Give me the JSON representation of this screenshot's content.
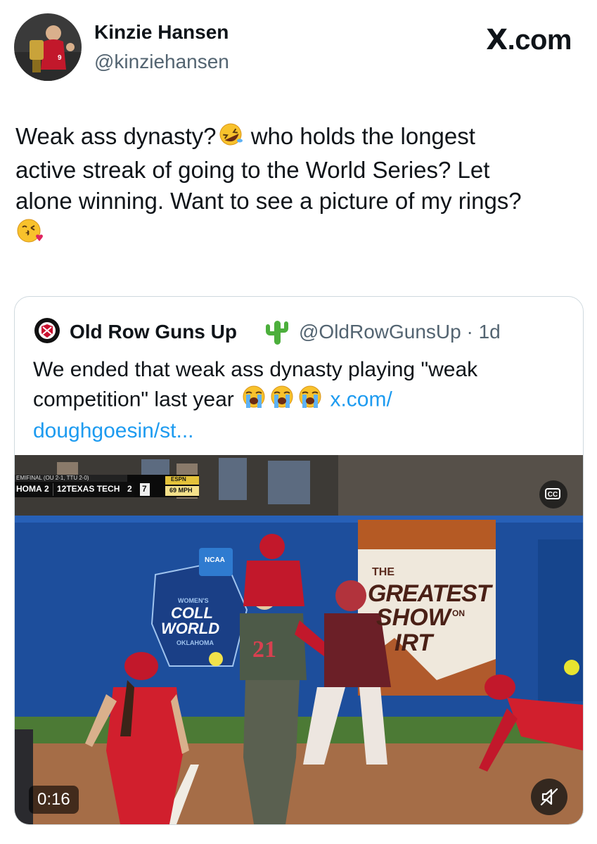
{
  "header": {
    "author_name": "Kinzie Hansen",
    "author_handle": "@kinziehansen",
    "site_label": ".com",
    "site_mark": "X",
    "avatar_icon": "profile-photo-softball-trophy"
  },
  "tweet": {
    "line1_a": "Weak ass dynasty?",
    "line1_b": " who holds the longest",
    "line2": "active streak of going to the World Series? Let",
    "line3": "alone winning. Want to see a picture of my rings?",
    "emojis": [
      "rolling-on-floor-laughing-emoji",
      "face-blowing-kiss-emoji"
    ]
  },
  "quote": {
    "name": "Old Row Guns Up",
    "handle_time": "@OldRowGunsUp · 1d",
    "text_a": "We ended that weak ass dynasty playing \"weak",
    "text_b": "competition\" last year",
    "link_a": "x.com/",
    "link_b": "doughgoesin/st...",
    "emojis": [
      "loudly-crying-face-emoji",
      "loudly-crying-face-emoji",
      "loudly-crying-face-emoji"
    ],
    "verified_icon": "cactus-emoji"
  },
  "video": {
    "scorebug_line1": "EMIFINAL (OU 2-1, TTU 2-0)",
    "scorebug_team1": "HOMA",
    "scorebug_score1": "2",
    "scorebug_team2": "12TEXAS TECH",
    "scorebug_score2": "2",
    "scorebug_inning": "7",
    "scorebug_network": "ESPN",
    "scorebug_speed": "69 MPH",
    "banner_the": "THE",
    "banner_greatest": "GREATEST",
    "banner_show": "SHOW",
    "banner_on": "ON",
    "banner_dirt": "IRT",
    "logo_line1": "WOMEN'S",
    "logo_line2": "COLL",
    "logo_line3": "WORLD",
    "logo_line4": "OKLAHOMA",
    "logo_ncaa": "NCAA",
    "jersey_number": "21",
    "duration": "0:16",
    "cc_label": "CC"
  }
}
